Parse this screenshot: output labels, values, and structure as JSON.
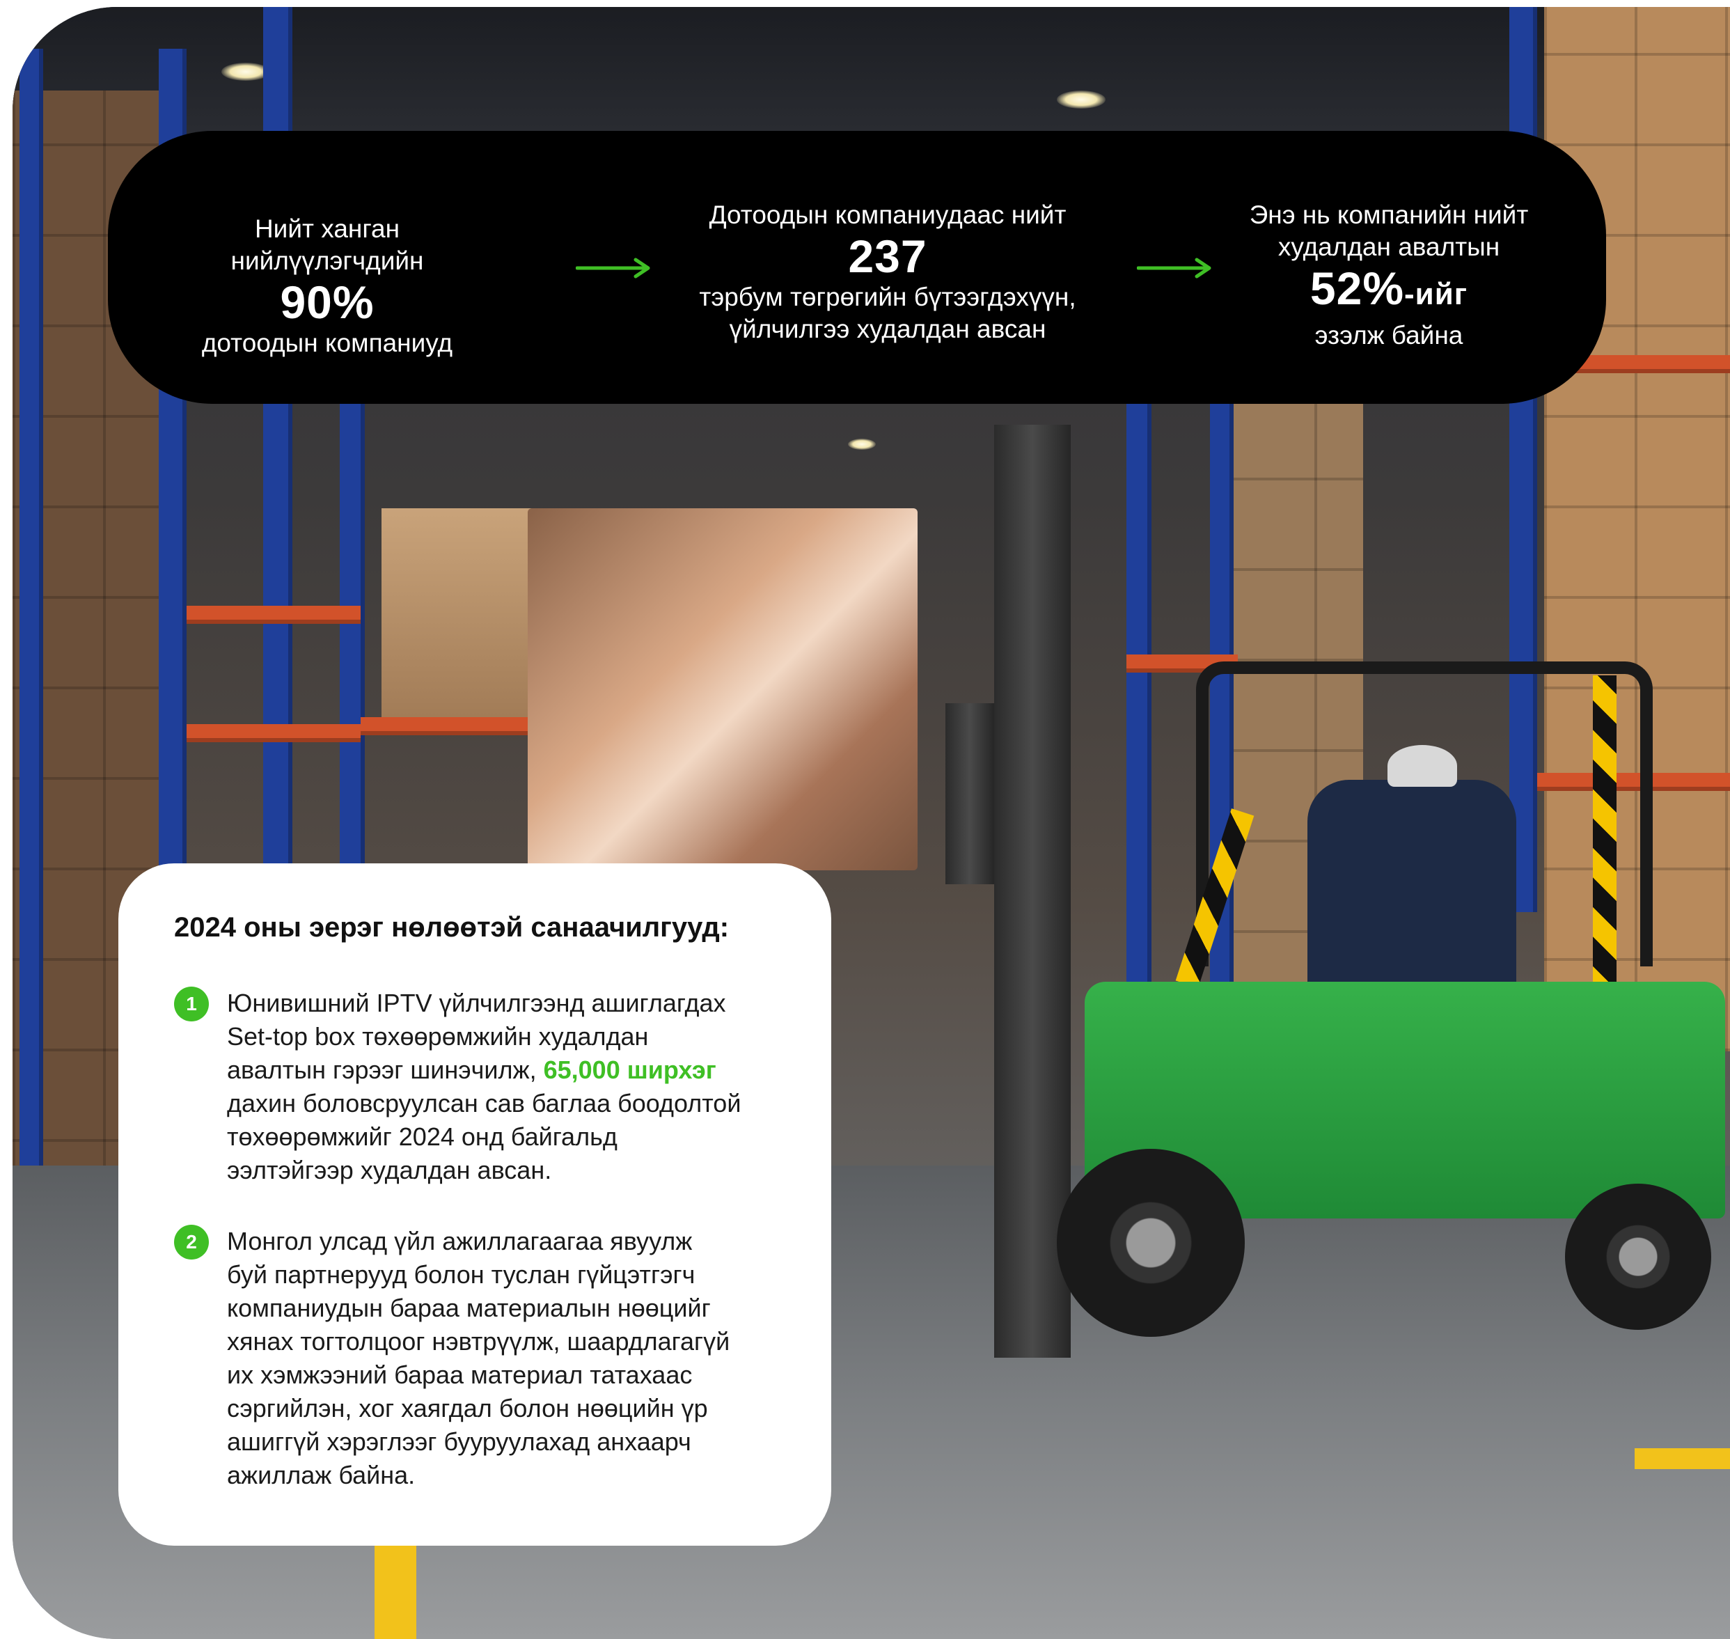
{
  "stats": [
    {
      "top_text": "Нийт ханган нийлүүлэгчдийн",
      "big": "90%",
      "bottom_text": "дотоодын компаниуд"
    },
    {
      "top_text": "Дотоодын компаниудаас нийт",
      "big": "237",
      "bottom_line1": "тэрбум төгрөгийн бүтээгдэхүүн,",
      "bottom_line2": "үйлчилгээ худалдан авсан"
    },
    {
      "top_line1": "Энэ нь компанийн нийт",
      "top_line2": "худалдан авалтын",
      "big": "52%",
      "big_suffix": "-ийг",
      "bottom_text": "эзэлж байна"
    }
  ],
  "initiatives": {
    "title": "2024 оны эерэг нөлөөтэй санаачилгууд:",
    "items": [
      {
        "number": "1",
        "lines": [
          "Юнивишний IPTV үйлчилгээнд ашиглагдах",
          "Set-top box төхөөрөмжийн худалдан",
          "авалтын гэрээг шинэчилж, "
        ],
        "highlight": "65,000 ширхэг",
        "lines_after": [
          "дахин боловсруулсан сав баглаа боодолтой",
          "төхөөрөмжийг 2024 онд байгальд",
          "ээлтэйгээр худалдан авсан."
        ]
      },
      {
        "number": "2",
        "lines": [
          "Монгол улсад үйл ажиллагаагаа явуулж",
          "буй партнерууд болон туслан гүйцэтгэгч",
          "компаниудын бараа материалын нөөцийг",
          "хянах тогтолцоог нэвтрүүлж, шаардлагагүй",
          "их хэмжээний бараа материал татахаас",
          "сэргийлэн, хог хаягдал болон нөөцийн үр",
          "ашиггүй хэрэглээг бууруулахад анхаарч",
          "ажиллаж байна."
        ]
      }
    ]
  },
  "colors": {
    "accent_green": "#3fbf25",
    "panel_black": "#000000",
    "card_white": "#ffffff"
  },
  "icons": [
    "arrow-right-icon",
    "arrow-right-icon"
  ]
}
